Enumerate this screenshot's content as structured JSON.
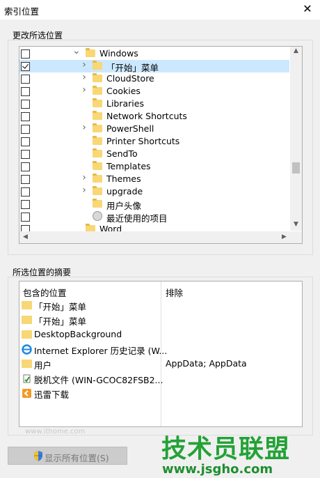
{
  "window": {
    "title": "索引位置",
    "close_glyph": "✕"
  },
  "change_group": {
    "label": "更改所选位置",
    "tree_rows": [
      {
        "label": "Windows",
        "checked": false,
        "expand": "open",
        "icon": "folder-icon",
        "level": 0,
        "selected": false
      },
      {
        "label": "「开始」菜单",
        "checked": true,
        "expand": "closed",
        "icon": "folder-icon",
        "level": 1,
        "selected": true
      },
      {
        "label": "CloudStore",
        "checked": false,
        "expand": "closed",
        "icon": "folder-icon",
        "level": 1,
        "selected": false
      },
      {
        "label": "Cookies",
        "checked": false,
        "expand": "closed",
        "icon": "folder-icon",
        "level": 1,
        "selected": false
      },
      {
        "label": "Libraries",
        "checked": false,
        "expand": "none",
        "icon": "folder-icon",
        "level": 1,
        "selected": false
      },
      {
        "label": "Network Shortcuts",
        "checked": false,
        "expand": "none",
        "icon": "folder-icon",
        "level": 1,
        "selected": false
      },
      {
        "label": "PowerShell",
        "checked": false,
        "expand": "closed",
        "icon": "folder-icon",
        "level": 1,
        "selected": false
      },
      {
        "label": "Printer Shortcuts",
        "checked": false,
        "expand": "none",
        "icon": "folder-icon",
        "level": 1,
        "selected": false
      },
      {
        "label": "SendTo",
        "checked": false,
        "expand": "none",
        "icon": "folder-icon",
        "level": 1,
        "selected": false
      },
      {
        "label": "Templates",
        "checked": false,
        "expand": "none",
        "icon": "folder-icon",
        "level": 1,
        "selected": false
      },
      {
        "label": "Themes",
        "checked": false,
        "expand": "closed",
        "icon": "folder-icon",
        "level": 1,
        "selected": false
      },
      {
        "label": "upgrade",
        "checked": false,
        "expand": "closed",
        "icon": "folder-icon",
        "level": 1,
        "selected": false
      },
      {
        "label": "用户头像",
        "checked": false,
        "expand": "none",
        "icon": "folder-icon",
        "level": 1,
        "selected": false
      },
      {
        "label": "最近使用的项目",
        "checked": false,
        "expand": "none",
        "icon": "recent-items-icon",
        "level": 1,
        "selected": false
      },
      {
        "label": "Word",
        "checked": false,
        "expand": "none",
        "icon": "folder-icon",
        "level": 0,
        "selected": false
      }
    ]
  },
  "summary_group": {
    "label": "所选位置的摘要",
    "col_included": "包含的位置",
    "col_excluded": "排除",
    "rows": [
      {
        "name": "「开始」菜单",
        "excluded": "",
        "icon": "folder-icon"
      },
      {
        "name": "「开始」菜单",
        "excluded": "",
        "icon": "folder-icon"
      },
      {
        "name": "DesktopBackground",
        "excluded": "",
        "icon": "folder-icon"
      },
      {
        "name": "Internet Explorer 历史记录 (W...",
        "excluded": "",
        "icon": "ie-icon"
      },
      {
        "name": "用户",
        "excluded": "AppData; AppData",
        "icon": "folder-icon"
      },
      {
        "name": "脱机文件 (WIN-GCOC82FSB2...",
        "excluded": "",
        "icon": "offline-files-icon"
      },
      {
        "name": "迅雷下载",
        "excluded": "",
        "icon": "thunder-download-icon"
      }
    ]
  },
  "show_all_button": {
    "label": "显示所有位置(S)"
  },
  "watermark": {
    "main": "技术员联盟",
    "url": "www.jsgho.com",
    "small": "www.ithome.com"
  },
  "colors": {
    "selection": "#cce8ff",
    "folder": "#f8d775",
    "watermark_green": "#23a236"
  }
}
